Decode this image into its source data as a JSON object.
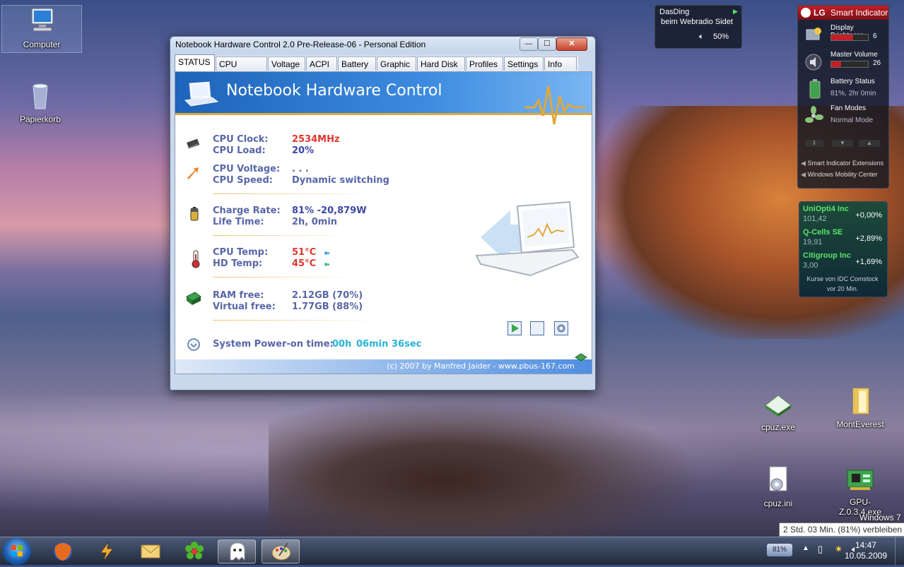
{
  "desktop": {
    "icons": [
      {
        "label": "Computer"
      },
      {
        "label": "Papierkorb"
      },
      {
        "label": "cpuz.exe"
      },
      {
        "label": "MontEverest"
      },
      {
        "label": "cpuz.ini"
      },
      {
        "label": "GPU-Z.0.3.4.exe"
      }
    ],
    "os_label": "Windows 7"
  },
  "window": {
    "title": "Notebook Hardware Control 2.0 Pre-Release-06  -  Personal Edition",
    "tabs": [
      "STATUS",
      "CPU Speed",
      "Voltage",
      "ACPI",
      "Battery",
      "Graphic",
      "Hard Disk",
      "Profiles",
      "Settings",
      "Info"
    ],
    "active_tab": "STATUS",
    "banner_title": "Notebook Hardware Control",
    "status": {
      "cpu_clock_label": "CPU Clock:",
      "cpu_clock_value": "2534MHz",
      "cpu_load_label": "CPU Load:",
      "cpu_load_value": "20%",
      "cpu_voltage_label": "CPU Voltage:",
      "cpu_voltage_value": ". . .",
      "cpu_speed_label": "CPU Speed:",
      "cpu_speed_value": "Dynamic switching",
      "charge_rate_label": "Charge Rate:",
      "charge_rate_value": "81%  -20,879W",
      "life_time_label": "Life Time:",
      "life_time_value": "2h, 0min",
      "cpu_temp_label": "CPU Temp:",
      "cpu_temp_value": "51°C",
      "hd_temp_label": "HD Temp:",
      "hd_temp_value": "45°C",
      "ram_free_label": "RAM free:",
      "ram_free_value": "2.12GB (70%)",
      "virtual_free_label": "Virtual free:",
      "virtual_free_value": "1.77GB (88%)",
      "power_on_label": "System Power-on time:",
      "power_on_h": "00h",
      "power_on_m": "06min",
      "power_on_s": "36sec"
    },
    "footer": "(c) 2007 by Manfred Jaider - www.pbus-167.com"
  },
  "radio_gadget": {
    "line1": "DasDing",
    "line2": "beim Webradio Sidet",
    "volume": "50%"
  },
  "lg_gadget": {
    "title": "Smart Indicator",
    "brand": "LG",
    "rows": [
      {
        "title": "Display Brightness",
        "value": "6",
        "level": 0.6
      },
      {
        "title": "Master Volume",
        "value": "26",
        "level": 0.26
      },
      {
        "title": "Battery Status",
        "sub": "81%, 2hr 0min"
      },
      {
        "title": "Fan Modes",
        "sub": "Normal Mode"
      }
    ],
    "links": [
      "Smart Indicator Extensions",
      "Windows Mobility Center"
    ]
  },
  "stocks": {
    "items": [
      {
        "name": "UniOpti4 Inc",
        "price": "101,42",
        "change": "+0,00%"
      },
      {
        "name": "Q-Cells SE",
        "price": "19,91",
        "change": "+2,89%"
      },
      {
        "name": "Citigroup Inc",
        "price": "3,00",
        "change": "+1,69%"
      }
    ],
    "footer_line1": "Kurse von IDC Comstock",
    "footer_line2": "vor 20 Min."
  },
  "taskbar": {
    "battery_badge": "81%",
    "time": "14:47",
    "date": "10.05.2009",
    "tooltip": "2 Std. 03 Min. (81%) verbleiben"
  }
}
